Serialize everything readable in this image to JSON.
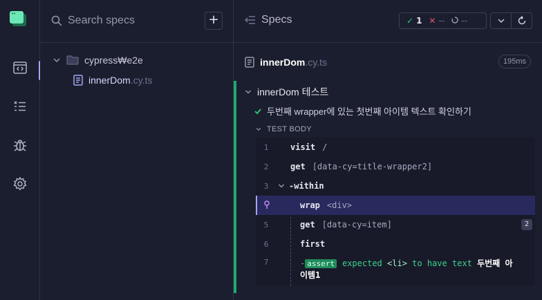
{
  "search": {
    "placeholder": "Search specs",
    "add_label": "+"
  },
  "tree": {
    "folder": "cypress₩e2e",
    "file_name": "innerDom",
    "file_ext": ".cy.ts"
  },
  "reporter": {
    "title": "Specs",
    "stats": {
      "passed": "1",
      "failed": "--",
      "pending": "--"
    },
    "spec_name": "innerDom",
    "spec_ext": ".cy.ts",
    "duration": "195ms",
    "suite_title": "innerDom 테스트",
    "test_title": "두번째 wrapper에 있는 첫번째 아이템 텍스트 확인하기",
    "body_title": "TEST BODY",
    "commands": [
      {
        "num": "1",
        "name": "visit",
        "arg": "/"
      },
      {
        "num": "2",
        "name": "get",
        "arg": "[data-cy=title-wrapper2]"
      },
      {
        "num": "3",
        "name": "within",
        "arg": ""
      },
      {
        "num": "",
        "name": "wrap",
        "arg": "<div>"
      },
      {
        "num": "5",
        "name": "get",
        "arg": "[data-cy=item]",
        "count": "2"
      },
      {
        "num": "6",
        "name": "first",
        "arg": ""
      },
      {
        "num": "7",
        "name": "assert",
        "arg": ""
      }
    ],
    "assertion": {
      "prefix": "-",
      "expected": "expected",
      "subject": "<li>",
      "middle": "to have text",
      "value_line1": "두번째 아",
      "value_line2": "이템1"
    }
  },
  "colors": {
    "accent": "#a3a7f5",
    "pass": "#1fa971",
    "fail": "#e1546d"
  }
}
